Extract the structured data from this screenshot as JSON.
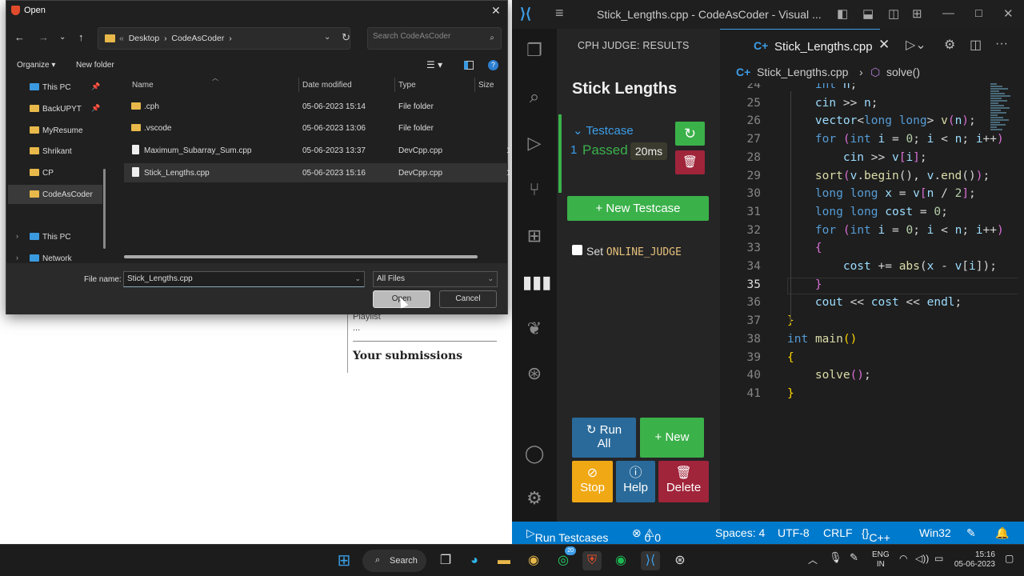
{
  "browser": {
    "playlist_label": "Playlist",
    "more": "...",
    "submissions_heading": "Your submissions"
  },
  "dialog": {
    "title": "Open",
    "address": {
      "ellipsis": "«",
      "path": [
        "Desktop",
        "CodeAsCoder"
      ],
      "sep": "›"
    },
    "search_placeholder": "Search CodeAsCoder",
    "organize": "Organize ▾",
    "new_folder": "New folder",
    "nav": [
      {
        "label": "This PC",
        "kind": "pc",
        "pinned": true
      },
      {
        "label": "BackUPYT",
        "kind": "folder",
        "pinned": true
      },
      {
        "label": "MyResume",
        "kind": "folder",
        "pinned": false
      },
      {
        "label": "Shrikant",
        "kind": "folder",
        "pinned": false
      },
      {
        "label": "CP",
        "kind": "folder",
        "pinned": false
      },
      {
        "label": "CodeAsCoder",
        "kind": "folder",
        "pinned": false,
        "selected": true
      },
      {
        "label": "This PC",
        "kind": "pc",
        "pinned": false,
        "expandable": true
      },
      {
        "label": "Network",
        "kind": "network",
        "pinned": false,
        "expandable": true
      }
    ],
    "columns": [
      "Name",
      "Date modified",
      "Type",
      "Size"
    ],
    "files": [
      {
        "name": ".cph",
        "date": "05-06-2023 15:14",
        "type": "File folder",
        "size": "",
        "kind": "folder"
      },
      {
        "name": ".vscode",
        "date": "05-06-2023 13:06",
        "type": "File folder",
        "size": "",
        "kind": "folder"
      },
      {
        "name": "Maximum_Subarray_Sum.cpp",
        "date": "05-06-2023 13:37",
        "type": "DevCpp.cpp",
        "size": "1",
        "kind": "file"
      },
      {
        "name": "Stick_Lengths.cpp",
        "date": "05-06-2023 15:16",
        "type": "DevCpp.cpp",
        "size": "1",
        "kind": "file",
        "selected": true
      }
    ],
    "file_name_label": "File name:",
    "file_name_value": "Stick_Lengths.cpp",
    "file_type": "All Files",
    "open_label": "Open",
    "cancel_label": "Cancel"
  },
  "vscode": {
    "title": "Stick_Lengths.cpp - CodeAsCoder - Visual ...",
    "panel_header": "CPH JUDGE: RESULTS",
    "problem": "Stick Lengths",
    "testcase": {
      "label": "Testcase",
      "number": "1",
      "status": "Passed",
      "time": "20ms"
    },
    "new_testcase": "New Testcase",
    "online_judge": {
      "prefix": "Set",
      "flag": "ONLINE_JUDGE"
    },
    "actions": {
      "run_all": [
        "Run",
        "All"
      ],
      "new": "New",
      "stop": "Stop",
      "help": "Help",
      "delete": "Delete"
    },
    "tab_name": "Stick_Lengths.cpp",
    "breadcrumb": {
      "file": "Stick_Lengths.cpp",
      "symbol": "solve()"
    },
    "current_line": 35,
    "status": {
      "run": "Run Testcases",
      "errors": "0",
      "warnings": "0",
      "spaces": "Spaces: 4",
      "encoding": "UTF-8",
      "eol": "CRLF",
      "language": "C++",
      "platform": "Win32"
    }
  },
  "taskbar": {
    "search": "Search",
    "whatsapp_badge": "20",
    "lang": [
      "ENG",
      "IN"
    ],
    "time": "15:16",
    "date": "05-06-2023"
  }
}
